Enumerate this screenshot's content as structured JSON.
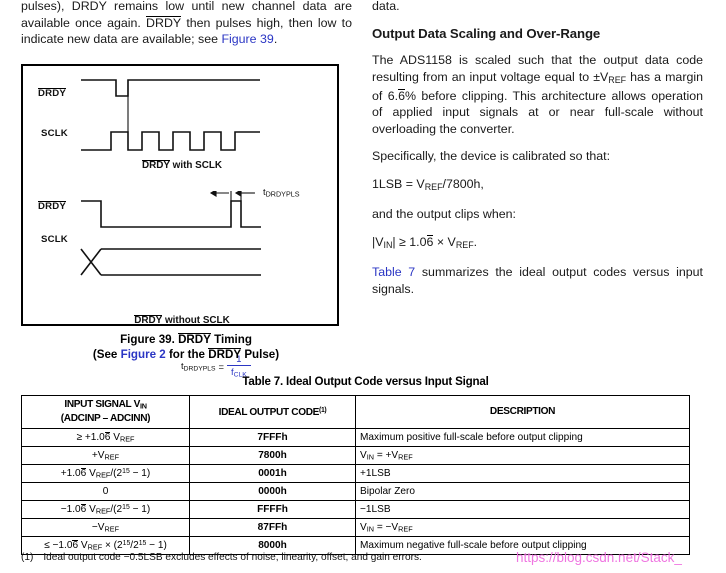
{
  "left_column": {
    "paragraph_html": "pulses), DRDY remains low until new channel data are available once again. <span class=\"ovl\">DRDY</span> then pulses high, then low to indicate new data are available; see <span class=\"link\">Figure 39</span>."
  },
  "figure": {
    "top_fragment_right": "data.",
    "diagram_a": {
      "signal_labels": [
        "DRDY",
        "SCLK"
      ],
      "caption": "DRDY with SCLK"
    },
    "diagram_b": {
      "signal_labels": [
        "DRDY",
        "SCLK"
      ],
      "caption": "DRDY without SCLK",
      "timing_label": "tDRDYPLS",
      "timing_label_base": "t",
      "timing_label_sub": "DRDYPLS"
    },
    "formula": {
      "lhs_base": "t",
      "lhs_sub": "DRDYPLS",
      "equals": "=",
      "numerator": "1",
      "denominator_base": "f",
      "denominator_sub": "CLK"
    },
    "caption_line1_pre": "Figure 39.  ",
    "caption_line1_overline": "DRDY",
    "caption_line1_post": " Timing",
    "caption_line2_pre": "(See ",
    "caption_line2_link": "Figure 2",
    "caption_line2_mid": " for the ",
    "caption_line2_overline": "DRDY",
    "caption_line2_post": " Pulse)"
  },
  "right_column": {
    "heading": "Output Data Scaling and Over-Range",
    "para1_html": "The ADS1158 is scaled such that the output data code resulting from an input voltage equal to ±V<sub>REF</sub> has a margin of 6.<span class=\"ovl\">6</span>% before clipping. This architecture allows operation of applied input signals at or near full-scale without overloading the converter.",
    "para2": "Specifically, the device is calibrated so that:",
    "eq1_html": "1LSB = V<sub>REF</sub>/7800h,",
    "para3": "and the output clips when:",
    "eq2_html": "|V<sub>IN</sub>| ≥ 1.0<span class=\"ovl\">6</span> × V<sub>REF</sub>.",
    "para4_link": "Table 7",
    "para4_rest": " summarizes the ideal output codes versus input signals."
  },
  "table": {
    "title": "Table 7. Ideal Output Code versus Input Signal",
    "headers": [
      "INPUT SIGNAL V<sub>IN</sub><br>(ADCINP – ADCINN)",
      "IDEAL OUTPUT CODE<sup>(1)</sup>",
      "DESCRIPTION"
    ],
    "rows": [
      {
        "input_signal": "≥ +1.0<span class=\"ovl\">6</span> V<sub>REF</sub>",
        "output_code": "7FFFh",
        "description": "Maximum positive full-scale before output clipping"
      },
      {
        "input_signal": "+V<sub>REF</sub>",
        "output_code": "7800h",
        "description": "V<sub>IN</sub> = +V<sub>REF</sub>"
      },
      {
        "input_signal": "+1.0<span class=\"ovl\">6</span> V<sub>REF</sub>/(2<sup>15</sup> − 1)",
        "output_code": "0001h",
        "description": "+1LSB"
      },
      {
        "input_signal": "0",
        "output_code": "0000h",
        "description": "Bipolar Zero"
      },
      {
        "input_signal": "−1.0<span class=\"ovl\">6</span> V<sub>REF</sub>/(2<sup>15</sup> − 1)",
        "output_code": "FFFFh",
        "description": "−1LSB"
      },
      {
        "input_signal": "−V<sub>REF</sub>",
        "output_code": "87FFh",
        "description": "V<sub>IN</sub> = −V<sub>REF</sub>"
      },
      {
        "input_signal": "≤ −1.0<span class=\"ovl\">6</span> V<sub>REF</sub> × (2<sup>15</sup>/2<sup>15</sup> − 1)",
        "output_code": "8000h",
        "description": "Maximum negative full-scale before output clipping"
      }
    ]
  },
  "footnote": {
    "marker": "(1)",
    "text": "Ideal output code −0.5LSB excludes effects of noise, linearity, offset, and gain errors."
  },
  "watermark": {
    "text": "https://blog.csdn.net/Stack_"
  },
  "colors": {
    "link": "#2b36c4",
    "watermark": "#ef6fe0",
    "text": "#1a1a1a",
    "rule": "#000000"
  }
}
